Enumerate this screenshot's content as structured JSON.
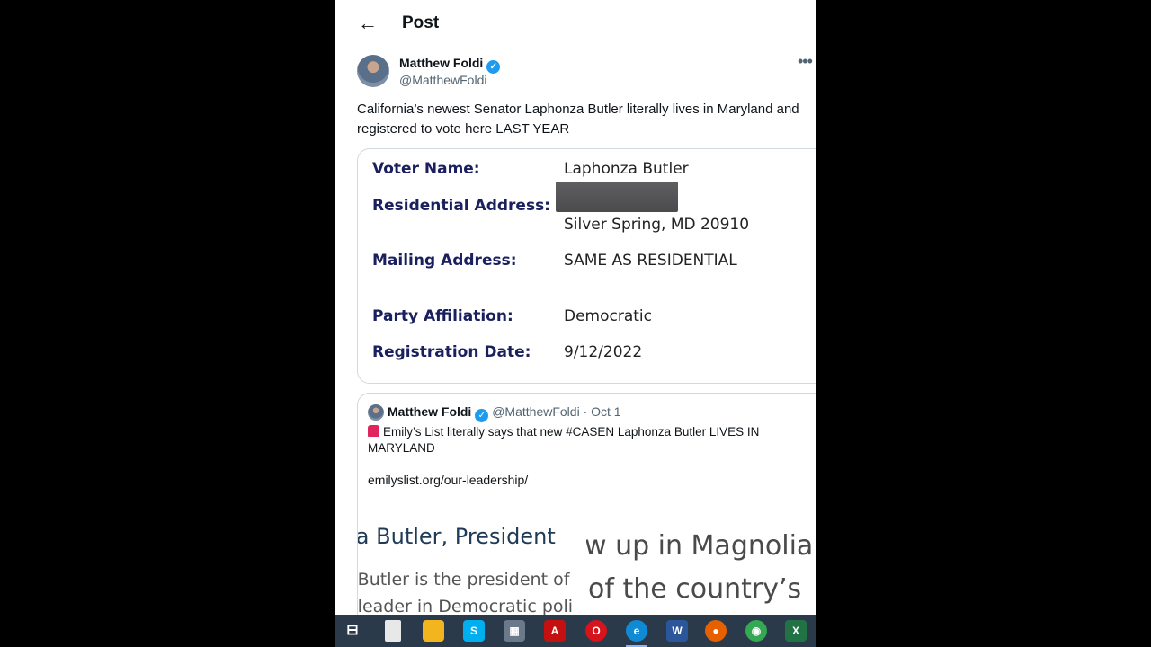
{
  "header": {
    "title": "Post"
  },
  "post": {
    "author_name": "Matthew Foldi",
    "handle": "@MatthewFoldi",
    "text": "California’s newest Senator Laphonza Butler literally lives in Maryland and registered to vote here LAST YEAR"
  },
  "voter_card": {
    "rows": [
      {
        "label": "Voter Name:",
        "value": "Laphonza Butler"
      },
      {
        "label": "Residential Address:",
        "value": "Silver Spring, MD 20910"
      },
      {
        "label": "Mailing Address:",
        "value": "SAME AS RESIDENTIAL"
      },
      {
        "label": "Party Affiliation:",
        "value": "Democratic"
      },
      {
        "label": "Registration Date:",
        "value": "9/12/2022"
      }
    ]
  },
  "quoted": {
    "author_name": "Matthew Foldi",
    "handle": "@MatthewFoldi",
    "date": "· Oct 1",
    "text": "Emily’s List literally says that new #CASEN Laphonza Butler LIVES IN MARYLAND",
    "link": "emilyslist.org/our-leadership/",
    "image_left": {
      "heading": "nza Butler, President",
      "line1": "a Butler is the president of",
      "line2": "a leader in Democratic poli"
    },
    "image_right": {
      "line1": "w up in Magnolia",
      "line2": "of the country’s"
    }
  },
  "taskbar": {
    "items": [
      {
        "icon": "task-view-icon",
        "glyph": "⊟",
        "color": "#2b3a4a"
      },
      {
        "icon": "file-icon",
        "glyph": "",
        "color": "#e8e8e8"
      },
      {
        "icon": "file-explorer-icon",
        "glyph": "",
        "color": "#f2b51d"
      },
      {
        "icon": "skype-icon",
        "glyph": "S",
        "color": "#00aff0"
      },
      {
        "icon": "calculator-icon",
        "glyph": "▦",
        "color": "#6b7a8a"
      },
      {
        "icon": "acrobat-icon",
        "glyph": "A",
        "color": "#c4100e"
      },
      {
        "icon": "opera-icon",
        "glyph": "O",
        "color": "#d7131b"
      },
      {
        "icon": "edge-icon",
        "glyph": "e",
        "color": "#0f8bd6"
      },
      {
        "icon": "word-icon",
        "glyph": "W",
        "color": "#2b579a"
      },
      {
        "icon": "firefox-icon",
        "glyph": "●",
        "color": "#e66000"
      },
      {
        "icon": "chrome-icon",
        "glyph": "◉",
        "color": "#34a853"
      },
      {
        "icon": "excel-icon",
        "glyph": "X",
        "color": "#217346"
      }
    ]
  }
}
